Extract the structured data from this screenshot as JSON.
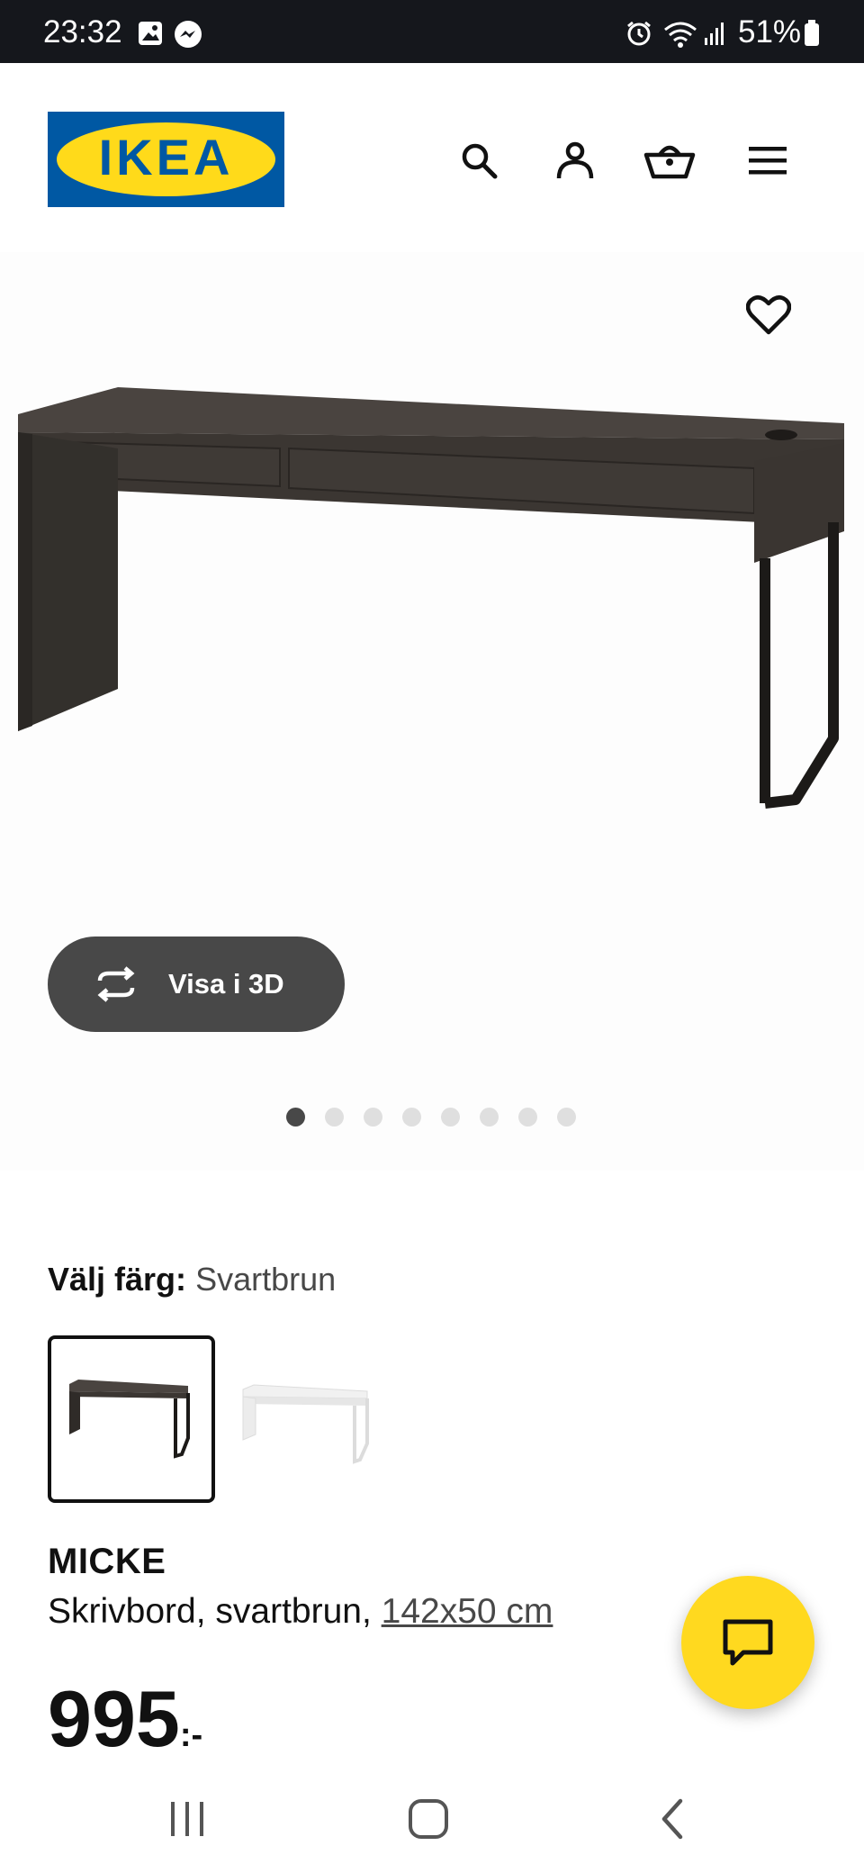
{
  "status_bar": {
    "time": "23:32",
    "battery": "51%",
    "icons": [
      "gallery-icon",
      "messenger-icon",
      "alarm-icon",
      "wifi-icon",
      "signal-icon",
      "battery-icon"
    ]
  },
  "header": {
    "logo_text": "IKEA",
    "icons": [
      "search-icon",
      "account-icon",
      "basket-icon",
      "menu-icon"
    ],
    "brand_colors": {
      "blue": "#0058a3",
      "yellow": "#ffda1a"
    }
  },
  "gallery": {
    "view_3d_label": "Visa i 3D",
    "dot_count": 8,
    "active_dot": 1
  },
  "product": {
    "color_label": "Välj färg:",
    "color_value": "Svartbrun",
    "swatches": [
      "Svartbrun",
      "Vit"
    ],
    "name": "MICKE",
    "description": "Skrivbord, svartbrun, ",
    "size_link": "142x50 cm",
    "price": "995",
    "price_suffix": ":-"
  },
  "chat": {
    "accent": "#ffd91f",
    "icon": "chat-icon"
  },
  "nav_bar": {
    "icons": [
      "recent-apps-icon",
      "home-icon",
      "back-icon"
    ]
  }
}
